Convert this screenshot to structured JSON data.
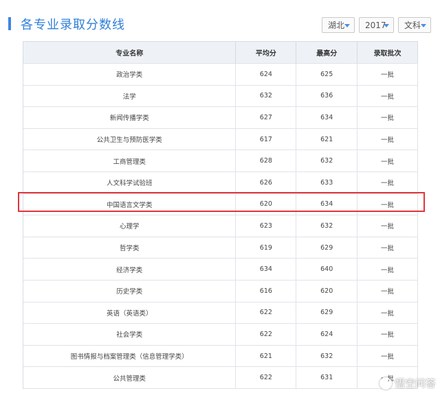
{
  "header": {
    "title": "各专业录取分数线",
    "filters": {
      "province": "湖北",
      "year": "2017",
      "subject": "文科"
    }
  },
  "table": {
    "columns": [
      "专业名称",
      "平均分",
      "最高分",
      "录取批次"
    ],
    "rows": [
      {
        "name": "政治学类",
        "avg": "624",
        "max": "625",
        "batch": "一批"
      },
      {
        "name": "法学",
        "avg": "632",
        "max": "636",
        "batch": "一批"
      },
      {
        "name": "新闻传播学类",
        "avg": "627",
        "max": "634",
        "batch": "一批"
      },
      {
        "name": "公共卫生与预防医学类",
        "avg": "617",
        "max": "621",
        "batch": "一批"
      },
      {
        "name": "工商管理类",
        "avg": "628",
        "max": "632",
        "batch": "一批"
      },
      {
        "name": "人文科学试验班",
        "avg": "626",
        "max": "633",
        "batch": "一批"
      },
      {
        "name": "中国语言文学类",
        "avg": "620",
        "max": "634",
        "batch": "一批"
      },
      {
        "name": "心理学",
        "avg": "623",
        "max": "632",
        "batch": "一批"
      },
      {
        "name": "哲学类",
        "avg": "619",
        "max": "629",
        "batch": "一批"
      },
      {
        "name": "经济学类",
        "avg": "634",
        "max": "640",
        "batch": "一批"
      },
      {
        "name": "历史学类",
        "avg": "616",
        "max": "620",
        "batch": "一批"
      },
      {
        "name": "英语（英语类）",
        "avg": "622",
        "max": "629",
        "batch": "一批"
      },
      {
        "name": "社会学类",
        "avg": "622",
        "max": "624",
        "batch": "一批"
      },
      {
        "name": "图书情报与档案管理类（信息管理学类）",
        "avg": "621",
        "max": "632",
        "batch": "一批"
      },
      {
        "name": "公共管理类",
        "avg": "622",
        "max": "631",
        "batch": "一批"
      }
    ],
    "highlighted_row": "中国语言文学类",
    "highlight_color": "#e0343a"
  },
  "watermark": {
    "text": "悟空问答",
    "icon": "wukong-logo-icon"
  },
  "colors": {
    "accent": "#3f86e0",
    "title": "#2f7fd8",
    "header_bg": "#eef2f7"
  }
}
